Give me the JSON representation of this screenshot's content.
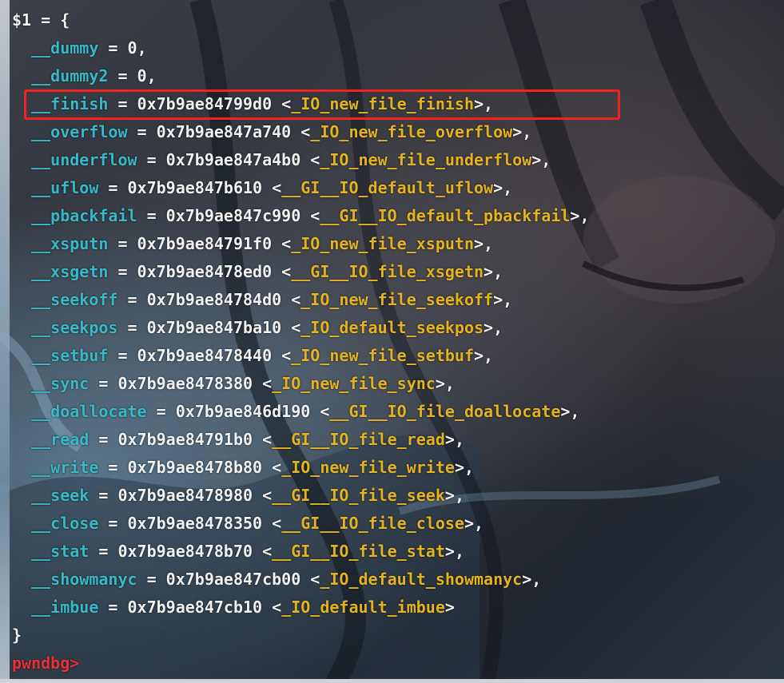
{
  "colors": {
    "field": "#39b8c9",
    "symbol": "#e3b321",
    "text": "#f2f2f2",
    "prompt": "#e8303a",
    "highlight": "#f2221e"
  },
  "header": "$1 = {",
  "fields": [
    {
      "indent": "  ",
      "name": "__dummy",
      "eq": " = ",
      "value": "0",
      "sym_open": "",
      "symbol": "",
      "sym_close": "",
      "tail": ","
    },
    {
      "indent": "  ",
      "name": "__dummy2",
      "eq": " = ",
      "value": "0",
      "sym_open": "",
      "symbol": "",
      "sym_close": "",
      "tail": ","
    },
    {
      "indent": "  ",
      "name": "__finish",
      "eq": " = ",
      "value": "0x7b9ae84799d0",
      "sym_open": " <",
      "symbol": "_IO_new_file_finish",
      "sym_close": ">",
      "tail": ","
    },
    {
      "indent": "  ",
      "name": "__overflow",
      "eq": " = ",
      "value": "0x7b9ae847a740",
      "sym_open": " <",
      "symbol": "_IO_new_file_overflow",
      "sym_close": ">",
      "tail": ","
    },
    {
      "indent": "  ",
      "name": "__underflow",
      "eq": " = ",
      "value": "0x7b9ae847a4b0",
      "sym_open": " <",
      "symbol": "_IO_new_file_underflow",
      "sym_close": ">",
      "tail": ","
    },
    {
      "indent": "  ",
      "name": "__uflow",
      "eq": " = ",
      "value": "0x7b9ae847b610",
      "sym_open": " <",
      "symbol": "__GI__IO_default_uflow",
      "sym_close": ">",
      "tail": ","
    },
    {
      "indent": "  ",
      "name": "__pbackfail",
      "eq": " = ",
      "value": "0x7b9ae847c990",
      "sym_open": " <",
      "symbol": "__GI__IO_default_pbackfail",
      "sym_close": ">",
      "tail": ","
    },
    {
      "indent": "  ",
      "name": "__xsputn",
      "eq": " = ",
      "value": "0x7b9ae84791f0",
      "sym_open": " <",
      "symbol": "_IO_new_file_xsputn",
      "sym_close": ">",
      "tail": ","
    },
    {
      "indent": "  ",
      "name": "__xsgetn",
      "eq": " = ",
      "value": "0x7b9ae8478ed0",
      "sym_open": " <",
      "symbol": "__GI__IO_file_xsgetn",
      "sym_close": ">",
      "tail": ","
    },
    {
      "indent": "  ",
      "name": "__seekoff",
      "eq": " = ",
      "value": "0x7b9ae84784d0",
      "sym_open": " <",
      "symbol": "_IO_new_file_seekoff",
      "sym_close": ">",
      "tail": ","
    },
    {
      "indent": "  ",
      "name": "__seekpos",
      "eq": " = ",
      "value": "0x7b9ae847ba10",
      "sym_open": " <",
      "symbol": "_IO_default_seekpos",
      "sym_close": ">",
      "tail": ","
    },
    {
      "indent": "  ",
      "name": "__setbuf",
      "eq": " = ",
      "value": "0x7b9ae8478440",
      "sym_open": " <",
      "symbol": "_IO_new_file_setbuf",
      "sym_close": ">",
      "tail": ","
    },
    {
      "indent": "  ",
      "name": "__sync",
      "eq": " = ",
      "value": "0x7b9ae8478380",
      "sym_open": " <",
      "symbol": "_IO_new_file_sync",
      "sym_close": ">",
      "tail": ","
    },
    {
      "indent": "  ",
      "name": "__doallocate",
      "eq": " = ",
      "value": "0x7b9ae846d190",
      "sym_open": " <",
      "symbol": "__GI__IO_file_doallocate",
      "sym_close": ">",
      "tail": ","
    },
    {
      "indent": "  ",
      "name": "__read",
      "eq": " = ",
      "value": "0x7b9ae84791b0",
      "sym_open": " <",
      "symbol": "__GI__IO_file_read",
      "sym_close": ">",
      "tail": ","
    },
    {
      "indent": "  ",
      "name": "__write",
      "eq": " = ",
      "value": "0x7b9ae8478b80",
      "sym_open": " <",
      "symbol": "_IO_new_file_write",
      "sym_close": ">",
      "tail": ","
    },
    {
      "indent": "  ",
      "name": "__seek",
      "eq": " = ",
      "value": "0x7b9ae8478980",
      "sym_open": " <",
      "symbol": "__GI__IO_file_seek",
      "sym_close": ">",
      "tail": ","
    },
    {
      "indent": "  ",
      "name": "__close",
      "eq": " = ",
      "value": "0x7b9ae8478350",
      "sym_open": " <",
      "symbol": "__GI__IO_file_close",
      "sym_close": ">",
      "tail": ","
    },
    {
      "indent": "  ",
      "name": "__stat",
      "eq": " = ",
      "value": "0x7b9ae8478b70",
      "sym_open": " <",
      "symbol": "__GI__IO_file_stat",
      "sym_close": ">",
      "tail": ","
    },
    {
      "indent": "  ",
      "name": "__showmanyc",
      "eq": " = ",
      "value": "0x7b9ae847cb00",
      "sym_open": " <",
      "symbol": "_IO_default_showmanyc",
      "sym_close": ">",
      "tail": ","
    },
    {
      "indent": "  ",
      "name": "__imbue",
      "eq": " = ",
      "value": "0x7b9ae847cb10",
      "sym_open": " <",
      "symbol": "_IO_default_imbue",
      "sym_close": ">",
      "tail": ""
    }
  ],
  "footer": "}",
  "prompt": "pwndbg>"
}
